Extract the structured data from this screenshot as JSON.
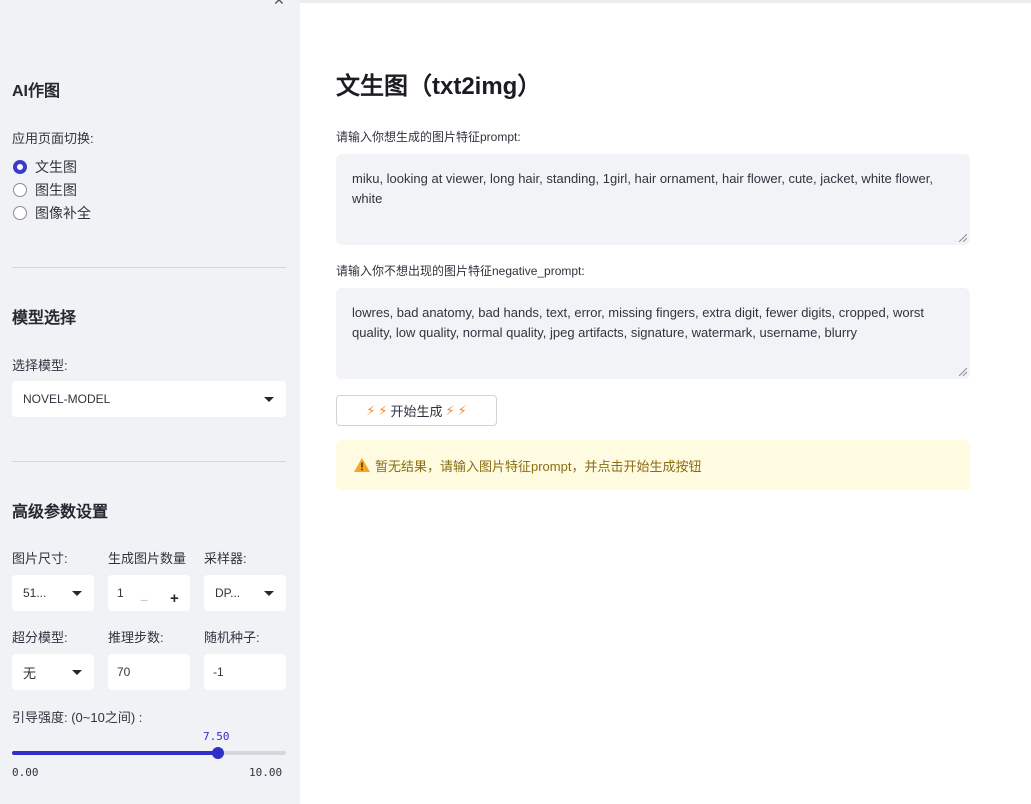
{
  "sidebar": {
    "collapse_icon": "collapse-icon",
    "section_ai": "AI作图",
    "page_switch_label": "应用页面切换:",
    "pages": [
      {
        "label": "文生图",
        "selected": true
      },
      {
        "label": "图生图",
        "selected": false
      },
      {
        "label": "图像补全",
        "selected": false
      }
    ],
    "section_model": "模型选择",
    "model_label": "选择模型:",
    "model_value": "NOVEL-MODEL",
    "section_advanced": "高级参数设置",
    "size_label": "图片尺寸:",
    "size_value": "51...",
    "count_label": "生成图片数量",
    "count_value": "1",
    "count_minus": "−",
    "count_plus": "+",
    "sampler_label": "采样器:",
    "sampler_value": "DP...",
    "upscale_label": "超分模型:",
    "upscale_value": "无",
    "steps_label": "推理步数:",
    "steps_value": "70",
    "seed_label": "随机种子:",
    "seed_value": "-1",
    "guidance_label": "引导强度: (0~10之间) :",
    "guidance_value": "7.50",
    "guidance_fraction": 0.75,
    "guidance_min": "0.00",
    "guidance_max": "10.00"
  },
  "main": {
    "title": "文生图（txt2img）",
    "prompt_label": "请输入你想生成的图片特征prompt:",
    "prompt_value": "miku, looking at viewer, long hair, standing, 1girl, hair ornament, hair flower, cute, jacket, white flower, white",
    "negative_label": "请输入你不想出现的图片特征negative_prompt:",
    "negative_value": "lowres, bad anatomy, bad hands, text, error, missing fingers, extra digit, fewer digits, cropped, worst quality, low quality, normal quality, jpeg artifacts, signature, watermark, username, blurry",
    "generate_button": "开始生成",
    "bolt_icon": "⚡",
    "warning_text": "暂无结果，请输入图片特征prompt，并点击开始生成按钮"
  },
  "colors": {
    "accent": "#3030c8",
    "sidebar_bg": "#f0f2f6",
    "warning_bg": "#fffbe0",
    "warning_text": "#8a6d13",
    "bolt": "#f08a2c"
  }
}
